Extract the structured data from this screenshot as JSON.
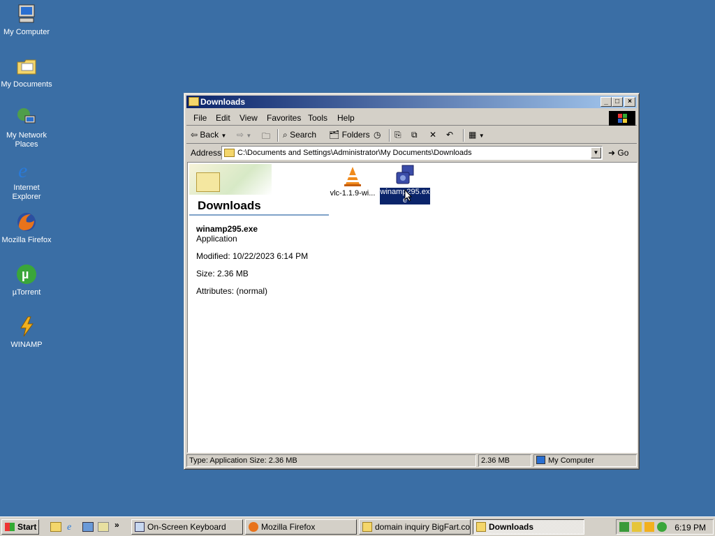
{
  "desktop": {
    "icons": [
      {
        "label": "My Computer"
      },
      {
        "label": "My Documents"
      },
      {
        "label": "My Network Places"
      },
      {
        "label": "Internet Explorer"
      },
      {
        "label": "Mozilla Firefox"
      },
      {
        "label": "µTorrent"
      },
      {
        "label": "WINAMP"
      }
    ]
  },
  "window": {
    "title": "Downloads",
    "menu": [
      "File",
      "Edit",
      "View",
      "Favorites",
      "Tools",
      "Help"
    ],
    "toolbar": {
      "back_label": "Back",
      "search_label": "Search",
      "folders_label": "Folders"
    },
    "address": {
      "label": "Address",
      "value": "C:\\Documents and Settings\\Administrator\\My Documents\\Downloads",
      "go_label": "Go"
    },
    "panel": {
      "title": "Downloads",
      "selected_name": "winamp295.exe",
      "selected_type": "Application",
      "modified": "Modified: 10/22/2023 6:14 PM",
      "size": "Size: 2.36 MB",
      "attributes": "Attributes: (normal)"
    },
    "files": [
      {
        "label": "vlc-1.1.9-wi...",
        "icon": "vlc-cone-icon",
        "selected": false
      },
      {
        "label": "winamp295.exe",
        "icon": "installer-icon",
        "selected": true
      }
    ],
    "status": {
      "left": "Type: Application Size: 2.36 MB",
      "middle": "2.36 MB",
      "right": "My Computer"
    }
  },
  "taskbar": {
    "start_label": "Start",
    "tasks": [
      {
        "label": "On-Screen Keyboard",
        "active": false
      },
      {
        "label": "Mozilla Firefox",
        "active": false
      },
      {
        "label": "domain inquiry BigFart.com",
        "active": false
      },
      {
        "label": "Downloads",
        "active": true
      }
    ],
    "clock": "6:19 PM"
  }
}
